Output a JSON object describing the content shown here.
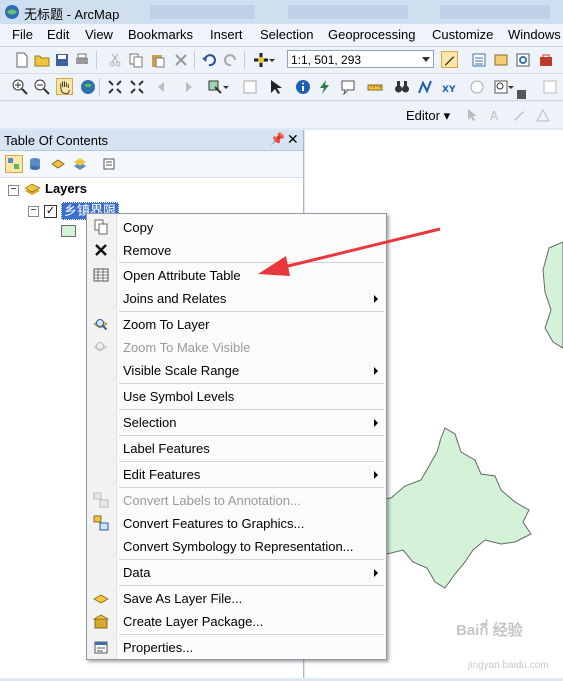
{
  "window": {
    "title": "无标题 - ArcMap"
  },
  "menubar": {
    "items": [
      "File",
      "Edit",
      "View",
      "Bookmarks",
      "Insert",
      "Selection",
      "Geoprocessing",
      "Customize",
      "Windows"
    ]
  },
  "toolbar": {
    "scale_value": "1:1, 501, 293"
  },
  "editor_toolbar": {
    "label": "Editor ▾"
  },
  "toc": {
    "title": "Table Of Contents",
    "pin_glyph": "⬣",
    "close_glyph": "✕",
    "root_label": "Layers",
    "layer_name": "乡镇界限",
    "layer_checked": true
  },
  "context_menu": {
    "items": [
      {
        "label": "Copy",
        "icon": "copy-icon",
        "enabled": true,
        "submenu": false
      },
      {
        "label": "Remove",
        "icon": "remove-icon",
        "enabled": true,
        "submenu": false
      },
      {
        "label": "Open Attribute Table",
        "icon": "table-icon",
        "enabled": true,
        "submenu": false
      },
      {
        "label": "Joins and Relates",
        "icon": "",
        "enabled": true,
        "submenu": true
      },
      {
        "label": "Zoom To Layer",
        "icon": "zoom-to-layer-icon",
        "enabled": true,
        "submenu": false
      },
      {
        "label": "Zoom To Make Visible",
        "icon": "zoom-visible-icon",
        "enabled": false,
        "submenu": false
      },
      {
        "label": "Visible Scale Range",
        "icon": "",
        "enabled": true,
        "submenu": true
      },
      {
        "label": "Use Symbol Levels",
        "icon": "",
        "enabled": true,
        "submenu": false
      },
      {
        "label": "Selection",
        "icon": "",
        "enabled": true,
        "submenu": true
      },
      {
        "label": "Label Features",
        "icon": "",
        "enabled": true,
        "submenu": false
      },
      {
        "label": "Edit Features",
        "icon": "",
        "enabled": true,
        "submenu": true
      },
      {
        "label": "Convert Labels to Annotation...",
        "icon": "convert-labels-icon",
        "enabled": false,
        "submenu": false
      },
      {
        "label": "Convert Features to Graphics...",
        "icon": "convert-features-icon",
        "enabled": true,
        "submenu": false
      },
      {
        "label": "Convert Symbology to Representation...",
        "icon": "",
        "enabled": true,
        "submenu": false
      },
      {
        "label": "Data",
        "icon": "",
        "enabled": true,
        "submenu": true
      },
      {
        "label": "Save As Layer File...",
        "icon": "layer-file-icon",
        "enabled": true,
        "submenu": false
      },
      {
        "label": "Create Layer Package...",
        "icon": "layer-package-icon",
        "enabled": true,
        "submenu": false
      },
      {
        "label": "Properties...",
        "icon": "properties-icon",
        "enabled": true,
        "submenu": false
      }
    ]
  },
  "colors": {
    "layer_fill": "#d3f2d8",
    "selection_highlight": "#3b6fd0",
    "callout_arrow": "#e8383b"
  },
  "watermark": {
    "main": "Baiกี่ 经验",
    "sub": "jingyan.baidu.com"
  }
}
